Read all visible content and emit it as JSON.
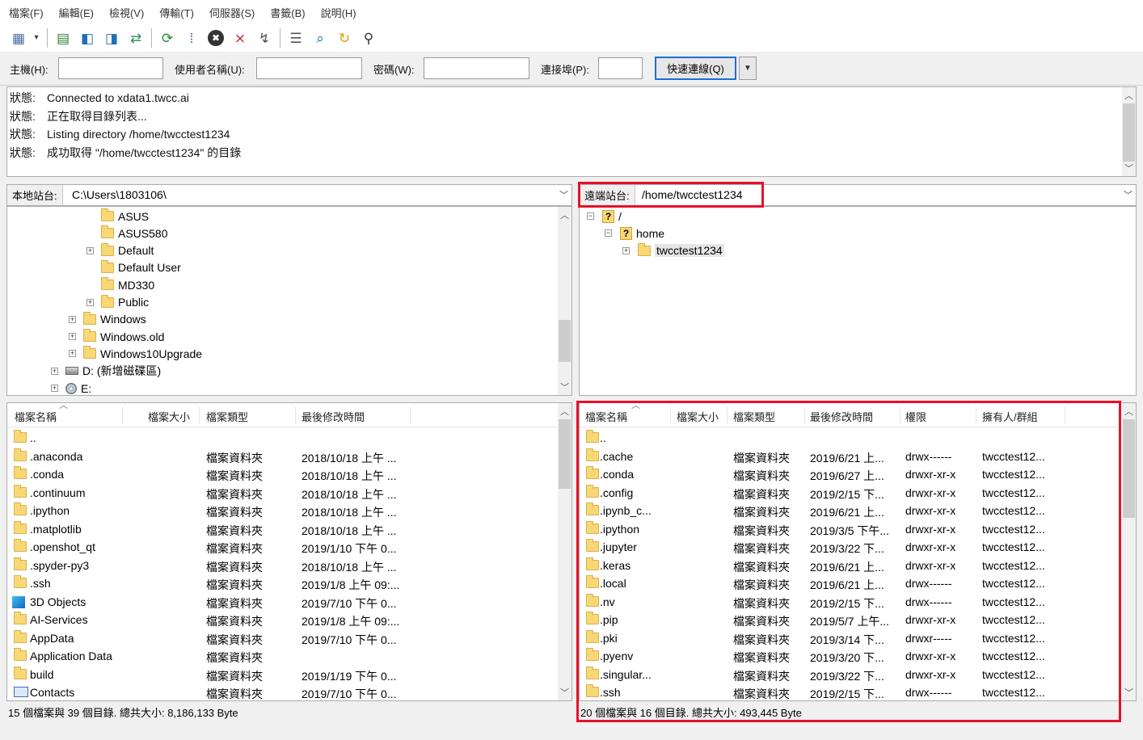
{
  "menu": [
    "檔案(F)",
    "編輯(E)",
    "檢視(V)",
    "傳輸(T)",
    "伺服器(S)",
    "書籤(B)",
    "說明(H)"
  ],
  "toolbar": [
    {
      "icon": "site-manager-icon",
      "glyph": "▦"
    },
    {
      "icon": "dropdown-arrow-icon",
      "glyph": "▾"
    },
    {
      "icon": "toggle-log-icon",
      "glyph": "▤"
    },
    {
      "icon": "toggle-local-tree-icon",
      "glyph": "◧"
    },
    {
      "icon": "toggle-remote-tree-icon",
      "glyph": "◨"
    },
    {
      "icon": "transfer-queue-icon",
      "glyph": "⇄"
    },
    {
      "icon": "refresh-icon",
      "glyph": "⟳"
    },
    {
      "icon": "process-queue-icon",
      "glyph": "⁞"
    },
    {
      "icon": "cancel-icon",
      "glyph": "✖"
    },
    {
      "icon": "disconnect-icon",
      "glyph": "⨯"
    },
    {
      "icon": "reconnect-icon",
      "glyph": "↯"
    },
    {
      "icon": "directory-filter-icon",
      "glyph": "☰"
    },
    {
      "icon": "compare-icon",
      "glyph": "⌕"
    },
    {
      "icon": "sync-browse-icon",
      "glyph": "↻"
    },
    {
      "icon": "search-files-icon",
      "glyph": "⚲"
    }
  ],
  "quickconnect": {
    "host_label": "主機(H):",
    "host_value": "",
    "user_label": "使用者名稱(U):",
    "user_value": "",
    "password_label": "密碼(W):",
    "password_value": "",
    "port_label": "連接埠(P):",
    "port_value": "",
    "connect_label": "快速連線(Q)"
  },
  "log": [
    {
      "tag": "狀態:",
      "text": "Connected to xdata1.twcc.ai"
    },
    {
      "tag": "狀態:",
      "text": "正在取得目錄列表..."
    },
    {
      "tag": "狀態:",
      "text": "Listing directory /home/twcctest1234"
    },
    {
      "tag": "狀態:",
      "text": "成功取得 \"/home/twcctest1234\" 的目錄"
    }
  ],
  "local": {
    "site_label": "本地站台:",
    "path": "C:\\Users\\1803106\\",
    "tree": [
      {
        "label": "ASUS",
        "icon": "folder",
        "expandable": false
      },
      {
        "label": "ASUS580",
        "icon": "folder",
        "expandable": false
      },
      {
        "label": "Default",
        "icon": "folder",
        "expandable": true
      },
      {
        "label": "Default User",
        "icon": "folder",
        "expandable": false
      },
      {
        "label": "MD330",
        "icon": "folder",
        "expandable": false
      },
      {
        "label": "Public",
        "icon": "folder",
        "expandable": true
      },
      {
        "label": "Windows",
        "icon": "folder",
        "expandable": true
      },
      {
        "label": "Windows.old",
        "icon": "folder",
        "expandable": true
      },
      {
        "label": "Windows10Upgrade",
        "icon": "folder",
        "expandable": true
      },
      {
        "label": "D: (新增磁碟區)",
        "icon": "drive",
        "expandable": true
      },
      {
        "label": "E:",
        "icon": "cd-drive",
        "expandable": true
      }
    ],
    "columns": [
      "檔案名稱",
      "檔案大小",
      "檔案類型",
      "最後修改時間"
    ],
    "files": [
      {
        "name": "..",
        "size": "",
        "type": "",
        "modified": "",
        "icon": "folder"
      },
      {
        "name": ".anaconda",
        "size": "",
        "type": "檔案資料夾",
        "modified": "2018/10/18 上午 ...",
        "icon": "folder"
      },
      {
        "name": ".conda",
        "size": "",
        "type": "檔案資料夾",
        "modified": "2018/10/18 上午 ...",
        "icon": "folder"
      },
      {
        "name": ".continuum",
        "size": "",
        "type": "檔案資料夾",
        "modified": "2018/10/18 上午 ...",
        "icon": "folder"
      },
      {
        "name": ".ipython",
        "size": "",
        "type": "檔案資料夾",
        "modified": "2018/10/18 上午 ...",
        "icon": "folder"
      },
      {
        "name": ".matplotlib",
        "size": "",
        "type": "檔案資料夾",
        "modified": "2018/10/18 上午 ...",
        "icon": "folder"
      },
      {
        "name": ".openshot_qt",
        "size": "",
        "type": "檔案資料夾",
        "modified": "2019/1/10 下午 0...",
        "icon": "folder"
      },
      {
        "name": ".spyder-py3",
        "size": "",
        "type": "檔案資料夾",
        "modified": "2018/10/18 上午 ...",
        "icon": "folder"
      },
      {
        "name": ".ssh",
        "size": "",
        "type": "檔案資料夾",
        "modified": "2019/1/8 上午 09:...",
        "icon": "folder"
      },
      {
        "name": "3D Objects",
        "size": "",
        "type": "檔案資料夾",
        "modified": "2019/7/10 下午 0...",
        "icon": "3d-objects"
      },
      {
        "name": "AI-Services",
        "size": "",
        "type": "檔案資料夾",
        "modified": "2019/1/8 上午 09:...",
        "icon": "folder"
      },
      {
        "name": "AppData",
        "size": "",
        "type": "檔案資料夾",
        "modified": "2019/7/10 下午 0...",
        "icon": "folder"
      },
      {
        "name": "Application Data",
        "size": "",
        "type": "檔案資料夾",
        "modified": "",
        "icon": "folder"
      },
      {
        "name": "build",
        "size": "",
        "type": "檔案資料夾",
        "modified": "2019/1/19 下午 0...",
        "icon": "folder"
      },
      {
        "name": "Contacts",
        "size": "",
        "type": "檔案資料夾",
        "modified": "2019/7/10 下午 0...",
        "icon": "contacts"
      }
    ],
    "summary": "15 個檔案與 39 個目錄. 總共大小: 8,186,133 Byte"
  },
  "remote": {
    "site_label": "遠端站台:",
    "path": "/home/twcctest1234",
    "tree": [
      {
        "label": "/",
        "icon": "unknown-folder",
        "expandable": true,
        "expanded": true
      },
      {
        "label": "home",
        "icon": "unknown-folder",
        "expandable": true,
        "expanded": true
      },
      {
        "label": "twcctest1234",
        "icon": "folder",
        "expandable": true,
        "expanded": false,
        "selected": true
      }
    ],
    "columns": [
      "檔案名稱",
      "檔案大小",
      "檔案類型",
      "最後修改時間",
      "權限",
      "擁有人/群組"
    ],
    "files": [
      {
        "name": "..",
        "size": "",
        "type": "",
        "modified": "",
        "perms": "",
        "owner": ""
      },
      {
        "name": ".cache",
        "size": "",
        "type": "檔案資料夾",
        "modified": "2019/6/21 上...",
        "perms": "drwx------",
        "owner": "twcctest12..."
      },
      {
        "name": ".conda",
        "size": "",
        "type": "檔案資料夾",
        "modified": "2019/6/27 上...",
        "perms": "drwxr-xr-x",
        "owner": "twcctest12..."
      },
      {
        "name": ".config",
        "size": "",
        "type": "檔案資料夾",
        "modified": "2019/2/15 下...",
        "perms": "drwxr-xr-x",
        "owner": "twcctest12..."
      },
      {
        "name": ".ipynb_c...",
        "size": "",
        "type": "檔案資料夾",
        "modified": "2019/6/21 上...",
        "perms": "drwxr-xr-x",
        "owner": "twcctest12..."
      },
      {
        "name": ".ipython",
        "size": "",
        "type": "檔案資料夾",
        "modified": "2019/3/5 下午...",
        "perms": "drwxr-xr-x",
        "owner": "twcctest12..."
      },
      {
        "name": ".jupyter",
        "size": "",
        "type": "檔案資料夾",
        "modified": "2019/3/22 下...",
        "perms": "drwxr-xr-x",
        "owner": "twcctest12..."
      },
      {
        "name": ".keras",
        "size": "",
        "type": "檔案資料夾",
        "modified": "2019/6/21 上...",
        "perms": "drwxr-xr-x",
        "owner": "twcctest12..."
      },
      {
        "name": ".local",
        "size": "",
        "type": "檔案資料夾",
        "modified": "2019/6/21 上...",
        "perms": "drwx------",
        "owner": "twcctest12..."
      },
      {
        "name": ".nv",
        "size": "",
        "type": "檔案資料夾",
        "modified": "2019/2/15 下...",
        "perms": "drwx------",
        "owner": "twcctest12..."
      },
      {
        "name": ".pip",
        "size": "",
        "type": "檔案資料夾",
        "modified": "2019/5/7 上午...",
        "perms": "drwxr-xr-x",
        "owner": "twcctest12..."
      },
      {
        "name": ".pki",
        "size": "",
        "type": "檔案資料夾",
        "modified": "2019/3/14 下...",
        "perms": "drwxr-----",
        "owner": "twcctest12..."
      },
      {
        "name": ".pyenv",
        "size": "",
        "type": "檔案資料夾",
        "modified": "2019/3/20 下...",
        "perms": "drwxr-xr-x",
        "owner": "twcctest12..."
      },
      {
        "name": ".singular...",
        "size": "",
        "type": "檔案資料夾",
        "modified": "2019/3/22 下...",
        "perms": "drwxr-xr-x",
        "owner": "twcctest12..."
      },
      {
        "name": ".ssh",
        "size": "",
        "type": "檔案資料夾",
        "modified": "2019/2/15 下...",
        "perms": "drwx------",
        "owner": "twcctest12..."
      }
    ],
    "summary": "20 個檔案與 16 個目錄. 總共大小: 493,445 Byte"
  },
  "colors": {
    "highlight": "#e8102a",
    "focus_border": "#1d6fd1",
    "folder": "#f8d775"
  }
}
